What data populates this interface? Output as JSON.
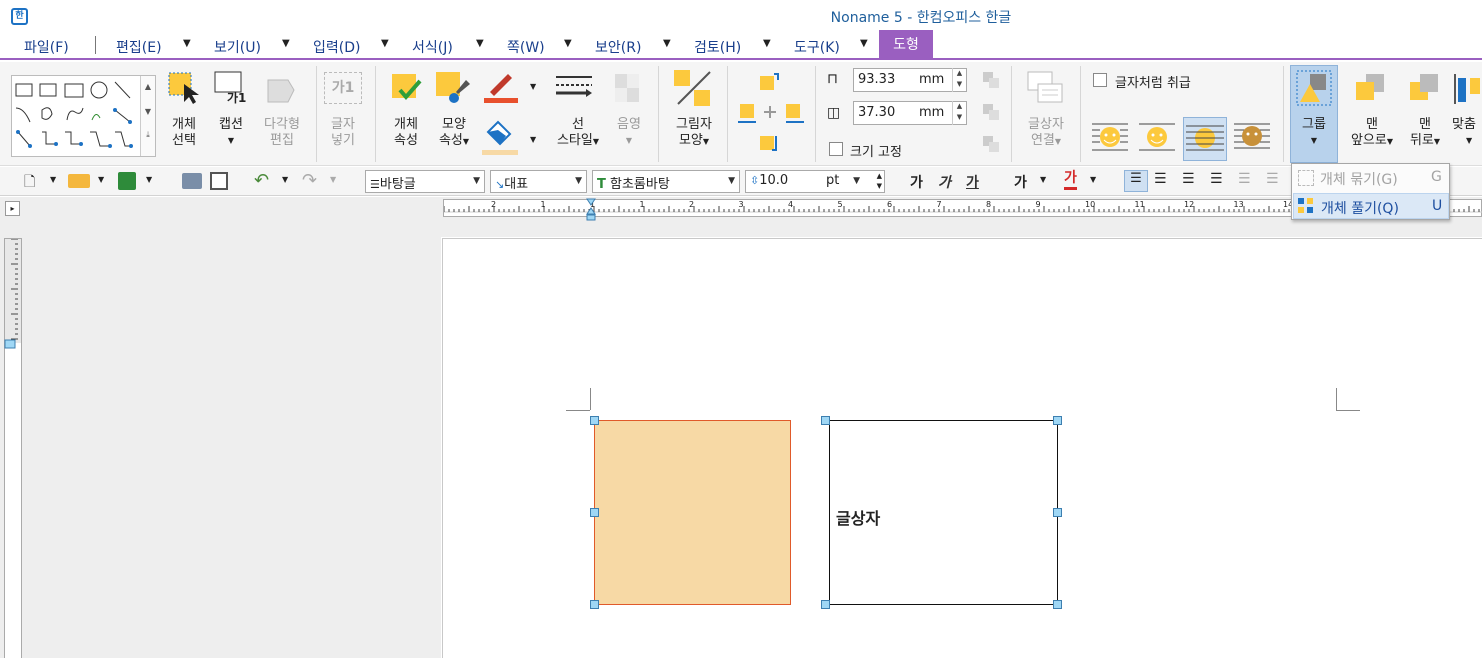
{
  "window": {
    "title": "Noname 5 - 한컴오피스 한글"
  },
  "menu": {
    "items": [
      "파일(F)",
      "편집(E)",
      "보기(U)",
      "입력(D)",
      "서식(J)",
      "쪽(W)",
      "보안(R)",
      "검토(H)",
      "도구(K)"
    ],
    "active_tab": "도형"
  },
  "ribbon": {
    "object_select": [
      "개체",
      "선택"
    ],
    "caption": [
      "캡션"
    ],
    "caption_glyph": "가1",
    "polygon_edit": [
      "다각형",
      "편집"
    ],
    "insert_text": [
      "글자",
      "넣기"
    ],
    "insert_text_glyph": "가1",
    "object_props": [
      "개체",
      "속성"
    ],
    "shape_props": [
      "모양",
      "속성"
    ],
    "line_style": [
      "선",
      "스타일"
    ],
    "shade": [
      "음영"
    ],
    "shadow_shape": [
      "그림자",
      "모양"
    ],
    "width": {
      "value": "93.33",
      "unit": "mm"
    },
    "height": {
      "value": "37.30",
      "unit": "mm"
    },
    "size_fixed": "크기 고정",
    "textbox_link": [
      "글상자",
      "연결"
    ],
    "treat_as_char": "글자처럼 취급",
    "group": [
      "그룹"
    ],
    "bring_front": [
      "맨",
      "앞으로"
    ],
    "send_back": [
      "맨",
      "뒤로"
    ],
    "align": [
      "맞춤"
    ]
  },
  "toolbar": {
    "style": "바탕글",
    "lang": "대표",
    "font": "함초롬바탕",
    "font_size": "10.0",
    "size_unit": "pt",
    "bold": "가",
    "italic": "가",
    "underline": "가",
    "strike": "가",
    "color": "가"
  },
  "ruler": {
    "labels": [
      "2",
      "1",
      "1",
      "1",
      "2",
      "3",
      "4",
      "5",
      "6",
      "7",
      "8",
      "9",
      "10",
      "11",
      "12",
      "13",
      "14"
    ]
  },
  "document": {
    "textbox_text": "글상자"
  },
  "dropdown": {
    "items": [
      {
        "label": "개체 묶기(G)",
        "key": "G",
        "enabled": false
      },
      {
        "label": "개체 풀기(Q)",
        "key": "U",
        "enabled": true
      }
    ]
  }
}
